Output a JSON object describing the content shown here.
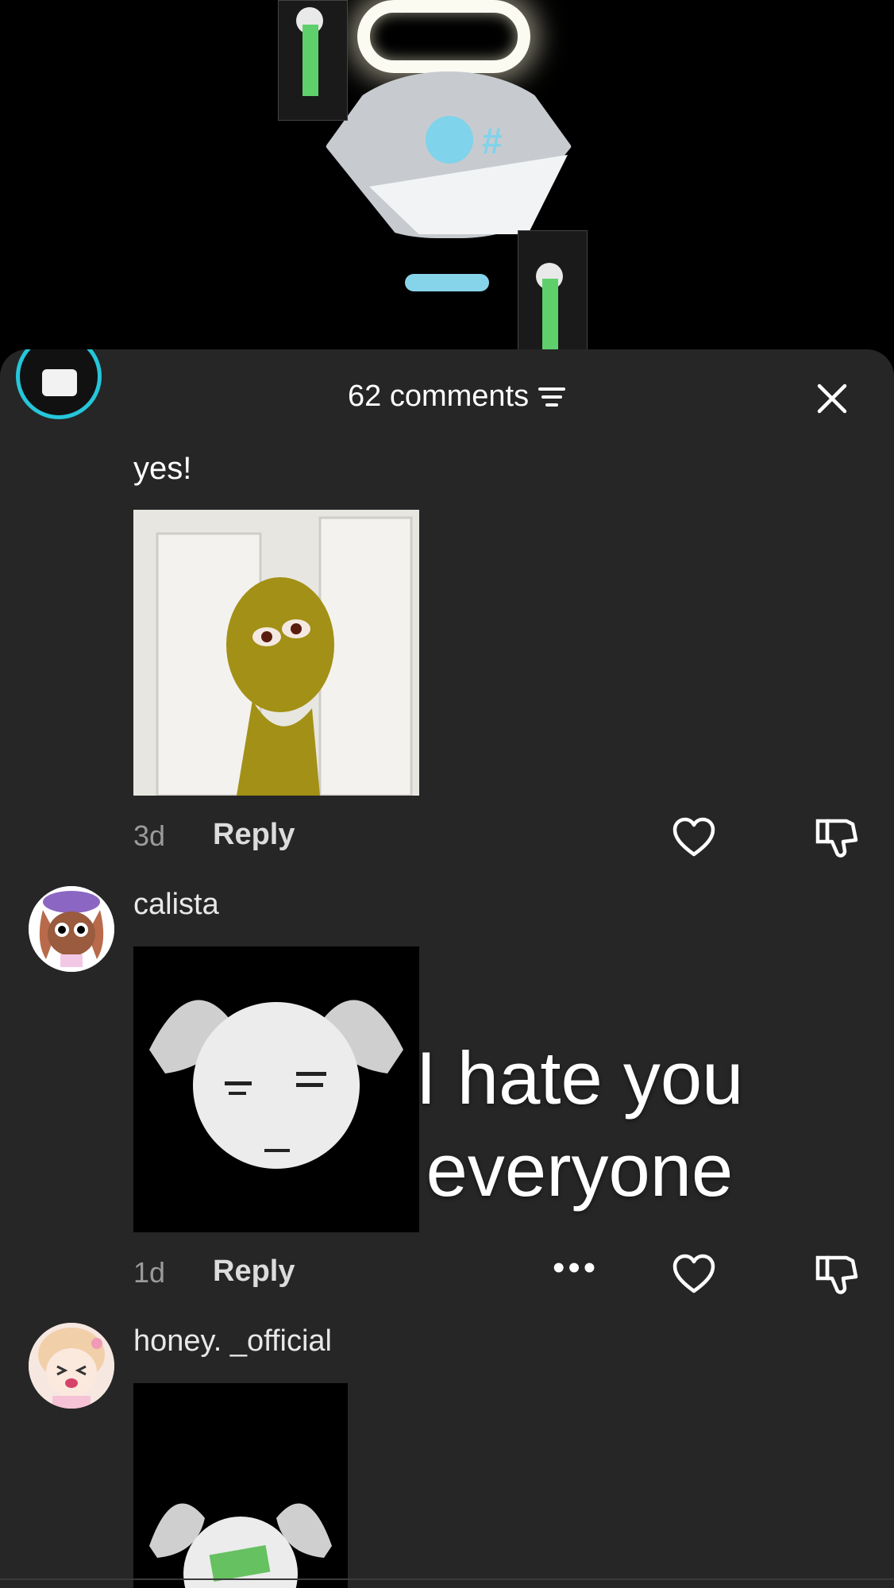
{
  "header": {
    "comments_label": "62 comments"
  },
  "comments": [
    {
      "text": "yes!",
      "time": "3d",
      "reply_label": "Reply"
    },
    {
      "username": "calista",
      "time": "1d",
      "reply_label": "Reply"
    },
    {
      "username": "honey. _official"
    }
  ],
  "overlay_caption": "I hate you everyone",
  "more_label": "•••",
  "icons": {
    "close": "close-icon",
    "filter": "sort-icon",
    "like": "heart-icon",
    "dislike": "thumbs-down-icon"
  },
  "colors": {
    "sheet_bg": "#262626",
    "video_bg": "#000000",
    "muted_text": "#9b9b9b"
  }
}
